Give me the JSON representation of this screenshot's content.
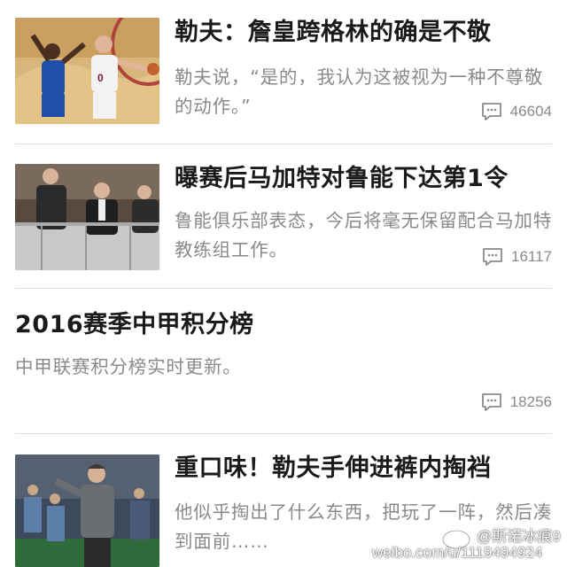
{
  "feed": {
    "items": [
      {
        "title": "勒夫：詹皇跨格林的确是不敬",
        "summary": "勒夫说，“是的，我认为这被视为一种不尊敬的动作。”",
        "comments": "46604",
        "image": "basketball-players-photo"
      },
      {
        "title": "曝赛后马加特对鲁能下达第1令",
        "summary": "鲁能俱乐部表态，今后将毫无保留配合马加特教练组工作。",
        "comments": "16117",
        "image": "officials-in-stands-photo"
      },
      {
        "title": "2016赛季中甲积分榜",
        "summary": "中甲联赛积分榜实时更新。",
        "comments": "18256"
      },
      {
        "title": "重口味！勒夫手伸进裤内掏裆",
        "summary": "他似乎掏出了什么东西，把玩了一阵，然后凑到面前……",
        "image": "coach-on-sideline-photo"
      }
    ]
  },
  "icons": {
    "comment": "comment-bubble-icon",
    "watermark": "weibo-logo-icon"
  },
  "watermark": {
    "handle": "@斯诺冰痕9",
    "url": "weibo.com/u/1119494924"
  },
  "colors": {
    "title": "#1a1a1a",
    "summary": "#8a8a8a",
    "divider": "#dedede"
  }
}
